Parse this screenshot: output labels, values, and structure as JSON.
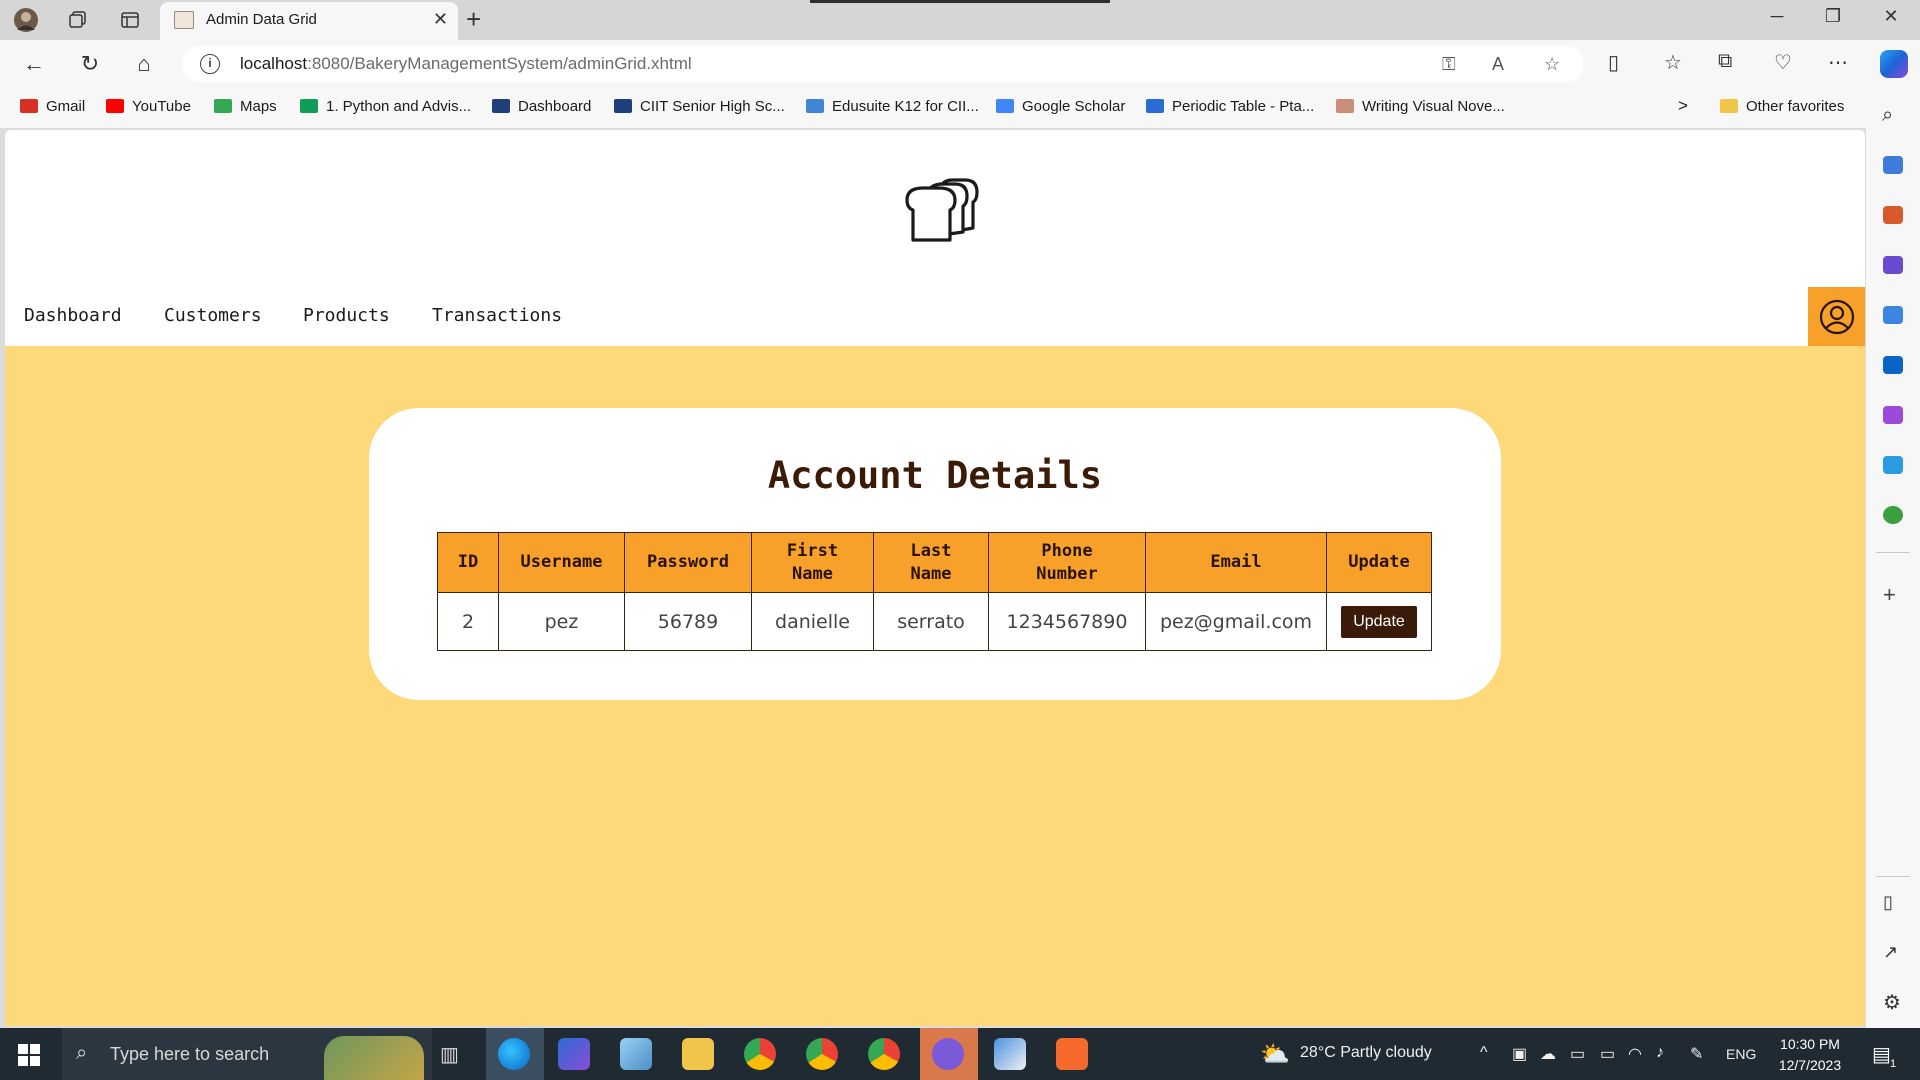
{
  "browser": {
    "tab_title": "Admin Data Grid",
    "tab_close": "✕",
    "new_tab": "+",
    "url_host": "localhost",
    "url_rest": ":8080/BakeryManagementSystem/adminGrid.xhtml",
    "bookmarks": [
      {
        "label": "Gmail",
        "color": "#d93025"
      },
      {
        "label": "YouTube",
        "color": "#ff0000"
      },
      {
        "label": "Maps",
        "color": "#34a853"
      },
      {
        "label": "1. Python and Advis...",
        "color": "#0f9d58"
      },
      {
        "label": "Dashboard",
        "color": "#1f3f7a"
      },
      {
        "label": "CIIT Senior High Sc...",
        "color": "#1f3f7a"
      },
      {
        "label": "Edusuite K12 for CII...",
        "color": "#3f86d6"
      },
      {
        "label": "Google Scholar",
        "color": "#4285f4"
      },
      {
        "label": "Periodic Table - Pta...",
        "color": "#2a6cd4"
      },
      {
        "label": "Writing Visual Nove...",
        "color": "#c98d7a"
      }
    ],
    "other_favorites": "Other favorites",
    "more_chevron": ">"
  },
  "nav": {
    "items": [
      "Dashboard",
      "Customers",
      "Products",
      "Transactions"
    ]
  },
  "card": {
    "title": "Account Details",
    "columns": [
      [
        "ID"
      ],
      [
        "Username"
      ],
      [
        "Password"
      ],
      [
        "First",
        "Name"
      ],
      [
        "Last",
        "Name"
      ],
      [
        "Phone",
        "Number"
      ],
      [
        "Email"
      ],
      [
        "Update"
      ]
    ],
    "rows": [
      {
        "id": "2",
        "username": "pez",
        "password": "56789",
        "first_name": "danielle",
        "last_name": "serrato",
        "phone": "1234567890",
        "email": "pez@gmail.com",
        "action": "Update"
      }
    ]
  },
  "taskbar": {
    "search_placeholder": "Type here to search",
    "weather": "28°C  Partly cloudy",
    "language": "ENG",
    "time": "10:30 PM",
    "date": "12/7/2023",
    "notification_count": "1"
  },
  "colors": {
    "accent_orange": "#f7a12a",
    "page_background": "#fdd97a",
    "dark_brown": "#3a1a08"
  }
}
